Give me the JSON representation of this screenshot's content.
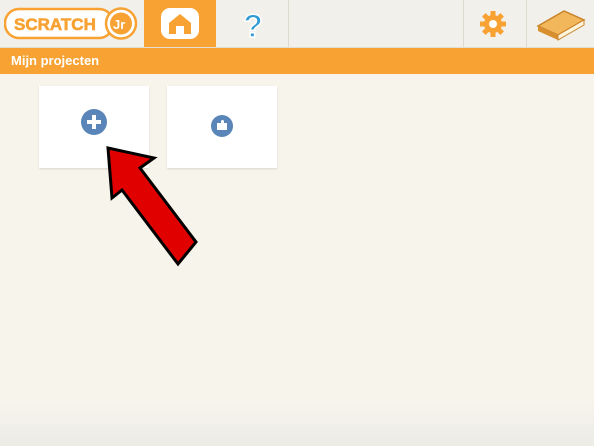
{
  "header": {
    "logo_text": "ScratchJr",
    "tabs": [
      {
        "name": "home",
        "icon": "home-icon",
        "active": true
      },
      {
        "name": "help",
        "icon": "question-mark-icon",
        "active": false
      }
    ],
    "settings_icon": "gear-icon",
    "book_icon": "book-icon"
  },
  "title_bar": {
    "label": "Mijn projecten"
  },
  "projects": [
    {
      "type": "new-project",
      "icon": "plus-icon"
    },
    {
      "type": "sample-project",
      "icon": "puzzle-icon"
    }
  ],
  "colors": {
    "accent": "#f7a233",
    "button_blue": "#5a85b8",
    "annotation_arrow": "#e00000"
  }
}
